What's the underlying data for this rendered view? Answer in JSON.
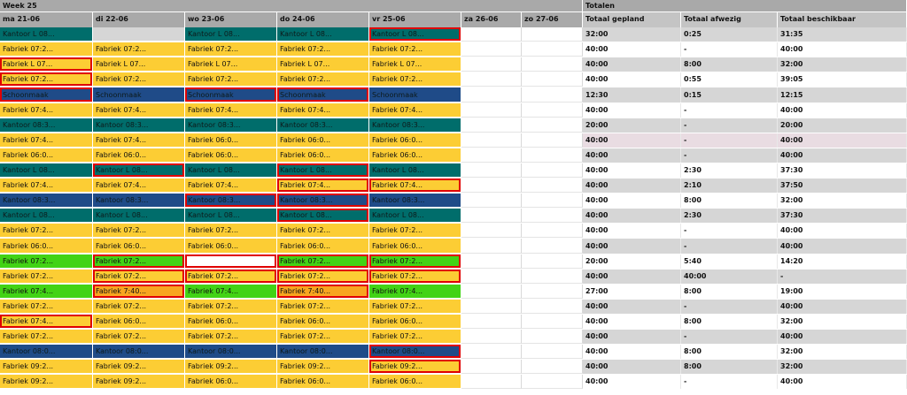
{
  "header": {
    "week_label": "Week 25",
    "totals_label": "Totalen",
    "days": [
      "ma 21-06",
      "di 22-06",
      "wo 23-06",
      "do 24-06",
      "vr 25-06",
      "za 26-06",
      "zo 27-06"
    ],
    "totals_columns": [
      "Totaal gepland",
      "Totaal afwezig",
      "Totaal beschikbaar"
    ]
  },
  "colors": {
    "yellow": "#fccd34",
    "teal": "#006d6b",
    "navy": "#1f4b88",
    "green": "#42d315",
    "orange": "#f8a51f",
    "gray": "#d6d6d6",
    "white": "#ffffff",
    "highlight": "#e00000"
  },
  "rows": [
    {
      "shifts": [
        {
          "t": "Kantoor L 08...",
          "c": "teal",
          "h": false
        },
        {
          "t": "",
          "c": "gray",
          "h": false
        },
        {
          "t": "Kantoor L 08...",
          "c": "teal",
          "h": false
        },
        {
          "t": "Kantoor L 08...",
          "c": "teal",
          "h": false
        },
        {
          "t": "Kantoor L 08...",
          "c": "teal",
          "h": true
        }
      ],
      "totals": [
        "32:00",
        "0:25",
        "31:35"
      ],
      "bg": "gray"
    },
    {
      "shifts": [
        {
          "t": "Fabriek 07:2...",
          "c": "yellow",
          "h": false
        },
        {
          "t": "Fabriek 07:2...",
          "c": "yellow",
          "h": false
        },
        {
          "t": "Fabriek 07:2...",
          "c": "yellow",
          "h": false
        },
        {
          "t": "Fabriek 07:2...",
          "c": "yellow",
          "h": false
        },
        {
          "t": "Fabriek 07:2...",
          "c": "yellow",
          "h": false
        }
      ],
      "totals": [
        "40:00",
        "-",
        "40:00"
      ],
      "bg": "white"
    },
    {
      "shifts": [
        {
          "t": "Fabriek L 07...",
          "c": "yellow",
          "h": true
        },
        {
          "t": "Fabriek L 07...",
          "c": "yellow",
          "h": false
        },
        {
          "t": "Fabriek L 07...",
          "c": "yellow",
          "h": false
        },
        {
          "t": "Fabriek L 07...",
          "c": "yellow",
          "h": false
        },
        {
          "t": "Fabriek L 07...",
          "c": "yellow",
          "h": false
        }
      ],
      "totals": [
        "40:00",
        "8:00",
        "32:00"
      ],
      "bg": "gray"
    },
    {
      "shifts": [
        {
          "t": "Fabriek 07:2...",
          "c": "yellow",
          "h": true
        },
        {
          "t": "Fabriek 07:2...",
          "c": "yellow",
          "h": false
        },
        {
          "t": "Fabriek 07:2...",
          "c": "yellow",
          "h": false
        },
        {
          "t": "Fabriek 07:2...",
          "c": "yellow",
          "h": false
        },
        {
          "t": "Fabriek 07:2...",
          "c": "yellow",
          "h": false
        }
      ],
      "totals": [
        "40:00",
        "0:55",
        "39:05"
      ],
      "bg": "white"
    },
    {
      "shifts": [
        {
          "t": "Schoonmaak",
          "c": "navy",
          "h": true
        },
        {
          "t": "Schoonmaak",
          "c": "navy",
          "h": false
        },
        {
          "t": "Schoonmaak",
          "c": "navy",
          "h": true
        },
        {
          "t": "Schoonmaak",
          "c": "navy",
          "h": true
        },
        {
          "t": "Schoonmaak",
          "c": "navy",
          "h": false
        }
      ],
      "totals": [
        "12:30",
        "0:15",
        "12:15"
      ],
      "bg": "gray"
    },
    {
      "shifts": [
        {
          "t": "Fabriek 07:4...",
          "c": "yellow",
          "h": false
        },
        {
          "t": "Fabriek 07:4...",
          "c": "yellow",
          "h": false
        },
        {
          "t": "Fabriek 07:4...",
          "c": "yellow",
          "h": false
        },
        {
          "t": "Fabriek 07:4...",
          "c": "yellow",
          "h": false
        },
        {
          "t": "Fabriek 07:4...",
          "c": "yellow",
          "h": false
        }
      ],
      "totals": [
        "40:00",
        "-",
        "40:00"
      ],
      "bg": "white"
    },
    {
      "shifts": [
        {
          "t": "Kantoor 08:3...",
          "c": "teal",
          "h": false
        },
        {
          "t": "Kantoor 08:3...",
          "c": "teal",
          "h": false
        },
        {
          "t": "Kantoor 08:3...",
          "c": "teal",
          "h": false
        },
        {
          "t": "Kantoor 08:3...",
          "c": "teal",
          "h": false
        },
        {
          "t": "Kantoor 08:3...",
          "c": "teal",
          "h": false
        }
      ],
      "totals": [
        "20:00",
        "-",
        "20:00"
      ],
      "bg": "gray"
    },
    {
      "shifts": [
        {
          "t": "Fabriek 07:4...",
          "c": "yellow",
          "h": false
        },
        {
          "t": "Fabriek 07:4...",
          "c": "yellow",
          "h": false
        },
        {
          "t": "Fabriek 06:0...",
          "c": "yellow",
          "h": false
        },
        {
          "t": "Fabriek 06:0...",
          "c": "yellow",
          "h": false
        },
        {
          "t": "Fabriek 06:0...",
          "c": "yellow",
          "h": false
        }
      ],
      "totals": [
        "40:00",
        "-",
        "40:00"
      ],
      "bg": "pink"
    },
    {
      "shifts": [
        {
          "t": "Fabriek 06:0...",
          "c": "yellow",
          "h": false
        },
        {
          "t": "Fabriek 06:0...",
          "c": "yellow",
          "h": false
        },
        {
          "t": "Fabriek 06:0...",
          "c": "yellow",
          "h": false
        },
        {
          "t": "Fabriek 06:0...",
          "c": "yellow",
          "h": false
        },
        {
          "t": "Fabriek 06:0...",
          "c": "yellow",
          "h": false
        }
      ],
      "totals": [
        "40:00",
        "-",
        "40:00"
      ],
      "bg": "gray"
    },
    {
      "shifts": [
        {
          "t": "Kantoor L 08...",
          "c": "teal",
          "h": false
        },
        {
          "t": "Kantoor L 08...",
          "c": "teal",
          "h": true
        },
        {
          "t": "Kantoor L 08...",
          "c": "teal",
          "h": false
        },
        {
          "t": "Kantoor L 08...",
          "c": "teal",
          "h": true
        },
        {
          "t": "Kantoor L 08...",
          "c": "teal",
          "h": false
        }
      ],
      "totals": [
        "40:00",
        "2:30",
        "37:30"
      ],
      "bg": "white"
    },
    {
      "shifts": [
        {
          "t": "Fabriek 07:4...",
          "c": "yellow",
          "h": false
        },
        {
          "t": "Fabriek 07:4...",
          "c": "yellow",
          "h": false
        },
        {
          "t": "Fabriek 07:4...",
          "c": "yellow",
          "h": false
        },
        {
          "t": "Fabriek 07:4...",
          "c": "yellow",
          "h": true
        },
        {
          "t": "Fabriek 07:4...",
          "c": "yellow",
          "h": true
        }
      ],
      "totals": [
        "40:00",
        "2:10",
        "37:50"
      ],
      "bg": "gray"
    },
    {
      "shifts": [
        {
          "t": "Kantoor 08:3...",
          "c": "navy",
          "h": false
        },
        {
          "t": "Kantoor 08:3...",
          "c": "navy",
          "h": false
        },
        {
          "t": "Kantoor 08:3...",
          "c": "navy",
          "h": true
        },
        {
          "t": "Kantoor 08:3...",
          "c": "navy",
          "h": true
        },
        {
          "t": "Kantoor 08:3...",
          "c": "navy",
          "h": false
        }
      ],
      "totals": [
        "40:00",
        "8:00",
        "32:00"
      ],
      "bg": "white"
    },
    {
      "shifts": [
        {
          "t": "Kantoor L 08...",
          "c": "teal",
          "h": false
        },
        {
          "t": "Kantoor L 08...",
          "c": "teal",
          "h": false
        },
        {
          "t": "Kantoor L 08...",
          "c": "teal",
          "h": false
        },
        {
          "t": "Kantoor L 08...",
          "c": "teal",
          "h": true
        },
        {
          "t": "Kantoor L 08...",
          "c": "teal",
          "h": false
        }
      ],
      "totals": [
        "40:00",
        "2:30",
        "37:30"
      ],
      "bg": "gray"
    },
    {
      "shifts": [
        {
          "t": "Fabriek 07:2...",
          "c": "yellow",
          "h": false
        },
        {
          "t": "Fabriek 07:2...",
          "c": "yellow",
          "h": false
        },
        {
          "t": "Fabriek 07:2...",
          "c": "yellow",
          "h": false
        },
        {
          "t": "Fabriek 07:2...",
          "c": "yellow",
          "h": false
        },
        {
          "t": "Fabriek 07:2...",
          "c": "yellow",
          "h": false
        }
      ],
      "totals": [
        "40:00",
        "-",
        "40:00"
      ],
      "bg": "white"
    },
    {
      "shifts": [
        {
          "t": "Fabriek 06:0...",
          "c": "yellow",
          "h": false
        },
        {
          "t": "Fabriek 06:0...",
          "c": "yellow",
          "h": false
        },
        {
          "t": "Fabriek 06:0...",
          "c": "yellow",
          "h": false
        },
        {
          "t": "Fabriek 06:0...",
          "c": "yellow",
          "h": false
        },
        {
          "t": "Fabriek 06:0...",
          "c": "yellow",
          "h": false
        }
      ],
      "totals": [
        "40:00",
        "-",
        "40:00"
      ],
      "bg": "gray"
    },
    {
      "shifts": [
        {
          "t": "Fabriek 07:2...",
          "c": "green",
          "h": false
        },
        {
          "t": "Fabriek 07:2...",
          "c": "green",
          "h": true
        },
        {
          "t": "",
          "c": "white",
          "h": true
        },
        {
          "t": "Fabriek 07:2...",
          "c": "green",
          "h": true
        },
        {
          "t": "Fabriek 07:2...",
          "c": "green",
          "h": true
        }
      ],
      "totals": [
        "20:00",
        "5:40",
        "14:20"
      ],
      "bg": "white"
    },
    {
      "shifts": [
        {
          "t": "Fabriek 07:2...",
          "c": "yellow",
          "h": false
        },
        {
          "t": "Fabriek 07:2...",
          "c": "yellow",
          "h": true
        },
        {
          "t": "Fabriek 07:2...",
          "c": "yellow",
          "h": true
        },
        {
          "t": "Fabriek 07:2...",
          "c": "yellow",
          "h": true
        },
        {
          "t": "Fabriek 07:2...",
          "c": "yellow",
          "h": true
        }
      ],
      "totals": [
        "40:00",
        "40:00",
        "-"
      ],
      "bg": "gray"
    },
    {
      "shifts": [
        {
          "t": "Fabriek 07:4...",
          "c": "green",
          "h": false
        },
        {
          "t": "Fabriek 7:40...",
          "c": "orange",
          "h": true
        },
        {
          "t": "Fabriek 07:4...",
          "c": "green",
          "h": false
        },
        {
          "t": "Fabriek 7:40...",
          "c": "orange",
          "h": true
        },
        {
          "t": "Fabriek 07:4...",
          "c": "green",
          "h": false
        }
      ],
      "totals": [
        "27:00",
        "8:00",
        "19:00"
      ],
      "bg": "white"
    },
    {
      "shifts": [
        {
          "t": "Fabriek 07:2...",
          "c": "yellow",
          "h": false
        },
        {
          "t": "Fabriek 07:2...",
          "c": "yellow",
          "h": false
        },
        {
          "t": "Fabriek 07:2...",
          "c": "yellow",
          "h": false
        },
        {
          "t": "Fabriek 07:2...",
          "c": "yellow",
          "h": false
        },
        {
          "t": "Fabriek 07:2...",
          "c": "yellow",
          "h": false
        }
      ],
      "totals": [
        "40:00",
        "-",
        "40:00"
      ],
      "bg": "gray"
    },
    {
      "shifts": [
        {
          "t": "Fabriek 07:4...",
          "c": "yellow",
          "h": true
        },
        {
          "t": "Fabriek 06:0...",
          "c": "yellow",
          "h": false
        },
        {
          "t": "Fabriek 06:0...",
          "c": "yellow",
          "h": false
        },
        {
          "t": "Fabriek 06:0...",
          "c": "yellow",
          "h": false
        },
        {
          "t": "Fabriek 06:0...",
          "c": "yellow",
          "h": false
        }
      ],
      "totals": [
        "40:00",
        "8:00",
        "32:00"
      ],
      "bg": "white"
    },
    {
      "shifts": [
        {
          "t": "Fabriek 07:2...",
          "c": "yellow",
          "h": false
        },
        {
          "t": "Fabriek 07:2...",
          "c": "yellow",
          "h": false
        },
        {
          "t": "Fabriek 07:2...",
          "c": "yellow",
          "h": false
        },
        {
          "t": "Fabriek 07:2...",
          "c": "yellow",
          "h": false
        },
        {
          "t": "Fabriek 07:2...",
          "c": "yellow",
          "h": false
        }
      ],
      "totals": [
        "40:00",
        "-",
        "40:00"
      ],
      "bg": "gray"
    },
    {
      "shifts": [
        {
          "t": "Kantoor 08:0...",
          "c": "navy",
          "h": false
        },
        {
          "t": "Kantoor 08:0...",
          "c": "navy",
          "h": false
        },
        {
          "t": "Kantoor 08:0...",
          "c": "navy",
          "h": false
        },
        {
          "t": "Kantoor 08:0...",
          "c": "navy",
          "h": false
        },
        {
          "t": "Kantoor 08:0...",
          "c": "navy",
          "h": true
        }
      ],
      "totals": [
        "40:00",
        "8:00",
        "32:00"
      ],
      "bg": "white"
    },
    {
      "shifts": [
        {
          "t": "Fabriek 09:2...",
          "c": "yellow",
          "h": false
        },
        {
          "t": "Fabriek 09:2...",
          "c": "yellow",
          "h": false
        },
        {
          "t": "Fabriek 09:2...",
          "c": "yellow",
          "h": false
        },
        {
          "t": "Fabriek 09:2...",
          "c": "yellow",
          "h": false
        },
        {
          "t": "Fabriek 09:2...",
          "c": "yellow",
          "h": true
        }
      ],
      "totals": [
        "40:00",
        "8:00",
        "32:00"
      ],
      "bg": "gray"
    },
    {
      "shifts": [
        {
          "t": "Fabriek 09:2...",
          "c": "yellow",
          "h": false
        },
        {
          "t": "Fabriek 09:2...",
          "c": "yellow",
          "h": false
        },
        {
          "t": "Fabriek 06:0...",
          "c": "yellow",
          "h": false
        },
        {
          "t": "Fabriek 06:0...",
          "c": "yellow",
          "h": false
        },
        {
          "t": "Fabriek 06:0...",
          "c": "yellow",
          "h": false
        }
      ],
      "totals": [
        "40:00",
        "-",
        "40:00"
      ],
      "bg": "white"
    }
  ]
}
